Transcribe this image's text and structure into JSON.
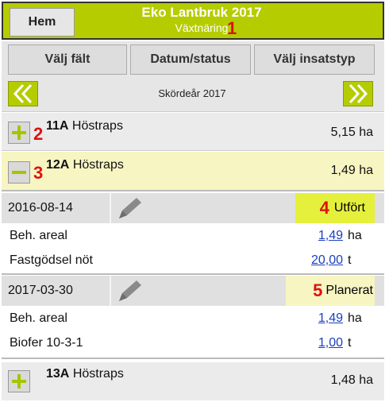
{
  "header": {
    "home_label": "Hem",
    "title": "Eko Lantbruk 2017",
    "subtitle": "Växtnäring",
    "annotation": "1"
  },
  "nav": {
    "select_field": "Välj fält",
    "date_status": "Datum/status",
    "select_input_type": "Välj insatstyp"
  },
  "year": {
    "label": "Skördeår 2017",
    "prev_icon": "double-chevron-left-icon",
    "next_icon": "double-chevron-right-icon"
  },
  "fields": [
    {
      "id": "11A",
      "crop": "Höstraps",
      "area": "5,15 ha",
      "expanded": false,
      "annotation": "2"
    },
    {
      "id": "12A",
      "crop": "Höstraps",
      "area": "1,49 ha",
      "expanded": true,
      "annotation": "3"
    },
    {
      "id": "13A",
      "crop": "Höstraps",
      "area": "1,48 ha",
      "expanded": false
    }
  ],
  "treatments": [
    {
      "date": "2016-08-14",
      "status": "Utfört",
      "status_color": "#e4f03c",
      "annotation": "4",
      "rows": [
        {
          "label": "Beh. areal",
          "value": "1,49",
          "unit": "ha"
        },
        {
          "label": "Fastgödsel nöt",
          "value": "20,00",
          "unit": "t"
        }
      ]
    },
    {
      "date": "2017-03-30",
      "status": "Planerat",
      "status_color": "#f7f5c2",
      "annotation": "5",
      "rows": [
        {
          "label": "Beh. areal",
          "value": "1,49",
          "unit": "ha"
        },
        {
          "label": "Biofer 10-3-1",
          "value": "1,00",
          "unit": "t"
        }
      ]
    }
  ],
  "colors": {
    "accent_green": "#b5cc00",
    "expanded_row": "#f7f5c2",
    "link_blue": "#1a3fbf",
    "annotation_red": "#d11111"
  }
}
